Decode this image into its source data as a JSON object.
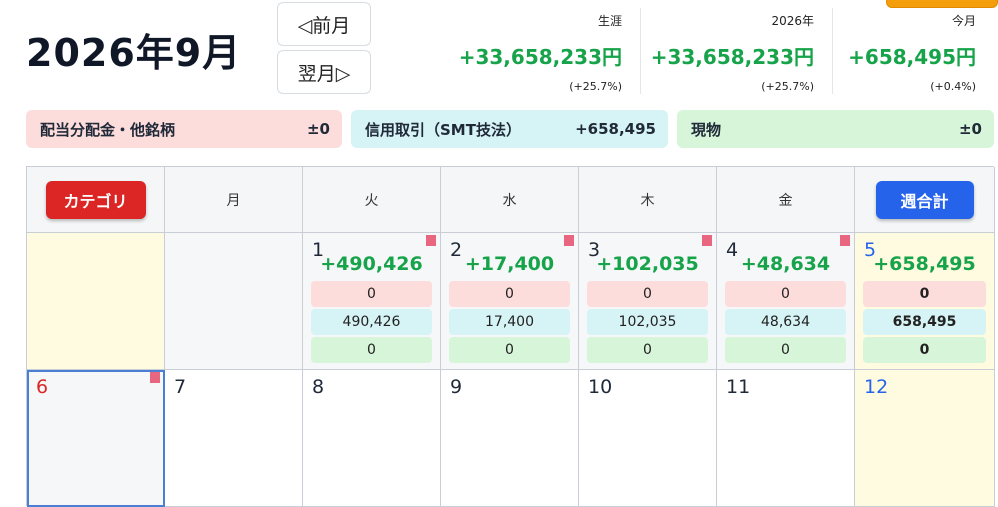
{
  "header": {
    "title": "2026年9月",
    "prev_label": "◁前月",
    "next_label": "翌月▷"
  },
  "summary": [
    {
      "label": "生涯",
      "value": "+33,658,233円",
      "pct": "(+25.7%)"
    },
    {
      "label": "2026年",
      "value": "+33,658,233円",
      "pct": "(+25.7%)"
    },
    {
      "label": "今月",
      "value": "+658,495円",
      "pct": "(+0.4%)"
    }
  ],
  "categories": [
    {
      "name": "配当分配金・他銘柄",
      "value": "±0"
    },
    {
      "name": "信用取引（SMT技法）",
      "value": "+658,495"
    },
    {
      "name": "現物",
      "value": "±0"
    }
  ],
  "calendar": {
    "category_button": "カテゴリ",
    "weekly_total_button": "週合計",
    "weekdays": [
      "月",
      "火",
      "水",
      "木",
      "金"
    ],
    "week1": [
      {
        "day": "1",
        "total": "+490,426",
        "dividend": "0",
        "margin": "490,426",
        "spot": "0"
      },
      {
        "day": "2",
        "total": "+17,400",
        "dividend": "0",
        "margin": "17,400",
        "spot": "0"
      },
      {
        "day": "3",
        "total": "+102,035",
        "dividend": "0",
        "margin": "102,035",
        "spot": "0"
      },
      {
        "day": "4",
        "total": "+48,634",
        "dividend": "0",
        "margin": "48,634",
        "spot": "0"
      }
    ],
    "week1_total": {
      "day": "5",
      "total": "+658,495",
      "dividend": "0",
      "margin": "658,495",
      "spot": "0"
    },
    "week2": [
      "6",
      "7",
      "8",
      "9",
      "10",
      "11",
      "12"
    ]
  },
  "colors": {
    "positive": "#16a34a",
    "dividend_bg": "#fddcdc",
    "margin_bg": "#d6f3f5",
    "spot_bg": "#d6f5d9",
    "category_button": "#dc2626",
    "week_button": "#2563eb"
  }
}
